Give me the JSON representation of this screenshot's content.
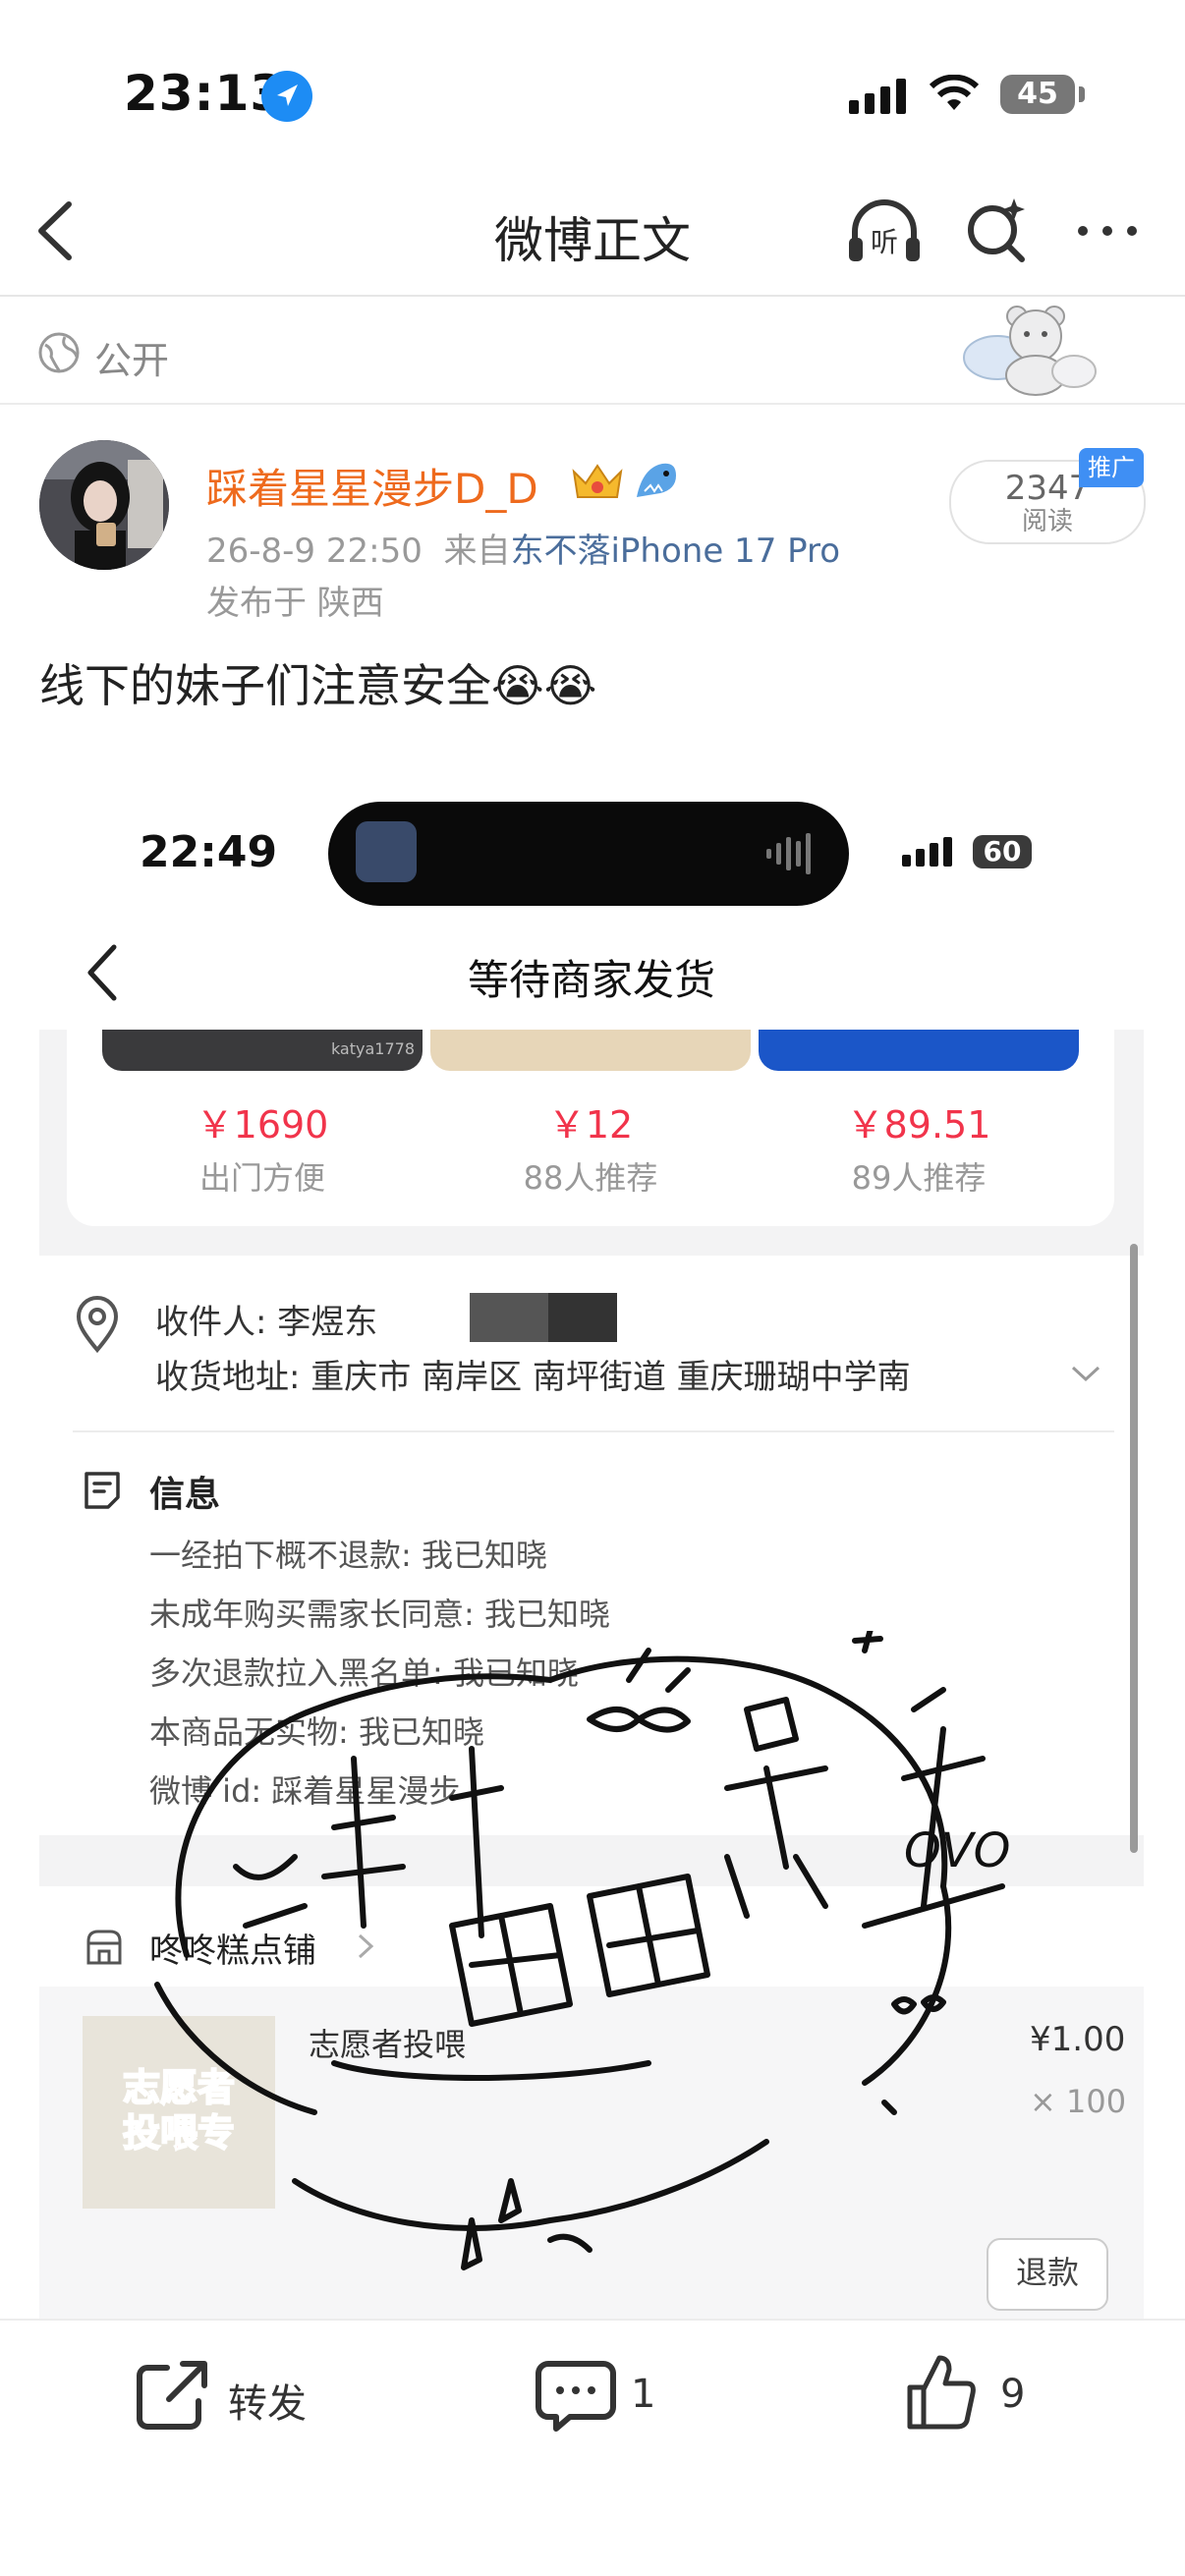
{
  "status_bar": {
    "time": "23:13",
    "battery": "45"
  },
  "nav": {
    "title": "微博正文"
  },
  "visibility": {
    "label": "公开"
  },
  "post": {
    "author": "踩着星星漫步D_D",
    "date": "26-8-9 22:50",
    "source_prefix": "来自",
    "source": "东不落iPhone 17 Pro",
    "location": "发布于 陕西",
    "text": "线下的妹子们注意安全😭😭",
    "reads_count": "2347",
    "reads_label": "阅读",
    "promo_badge": "推广"
  },
  "embedded_screenshot": {
    "status_time": "22:49",
    "battery": "60",
    "title": "等待商家发货",
    "recommendations": [
      {
        "price": "￥1690",
        "subtitle": "出门方便",
        "image_caption": "katya1778"
      },
      {
        "price": "￥12",
        "subtitle": "88人推荐"
      },
      {
        "price": "￥89.51",
        "subtitle": "89人推荐"
      }
    ],
    "recipient_label": "收件人:  李煜东",
    "address_label": "收货地址:  重庆市 南岸区 南坪街道  重庆珊瑚中学南",
    "info_title": "信息",
    "info_lines": [
      "一经拍下概不退款: 我已知晓",
      "未成年购买需家长同意: 我已知晓",
      "多次退款拉入黑名单: 我已知晓",
      "本商品无实物: 我已知晓",
      "微博 id: 踩着星星漫步"
    ],
    "shop_name": "咚咚糕点铺",
    "item": {
      "thumb_text_line1": "志愿者",
      "thumb_text_line2": "投喂专",
      "title": "志愿者投喂",
      "price": "¥1.00",
      "qty": "× 100",
      "refund_label": "退款"
    }
  },
  "watermark": {
    "line1": "踩着",
    "line2": "漫步",
    "line3": "星星",
    "tag": "OVO"
  },
  "actions": {
    "share_label": "转发",
    "comment_count": "1",
    "like_count": "9"
  }
}
